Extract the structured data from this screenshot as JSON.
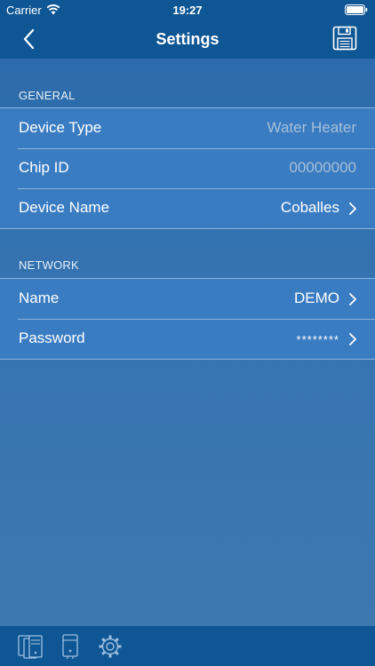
{
  "status_bar": {
    "carrier": "Carrier",
    "time": "19:27",
    "icons": [
      "wifi-icon",
      "battery-icon"
    ]
  },
  "nav": {
    "title": "Settings",
    "back_icon": "chevron-left-icon",
    "save_icon": "floppy-disk-icon"
  },
  "general": {
    "header": "GENERAL",
    "rows": [
      {
        "label": "Device Type",
        "value": "Water Heater"
      },
      {
        "label": "Chip ID",
        "value": "00000000"
      },
      {
        "label": "Device Name",
        "value": "Coballes"
      }
    ]
  },
  "network": {
    "header": "NETWORK",
    "rows": [
      {
        "label": "Name",
        "value": "DEMO"
      },
      {
        "label": "Password",
        "value": "********"
      }
    ]
  },
  "tab_bar": {
    "items": [
      "devices-icon",
      "water-heater-icon",
      "gear-icon"
    ]
  },
  "colors": {
    "bar": "#0f5694",
    "background": "#2b69aa",
    "row": "#3a7cc2",
    "separator": "#8bb3db",
    "muted_text": "#a7bfd8"
  }
}
